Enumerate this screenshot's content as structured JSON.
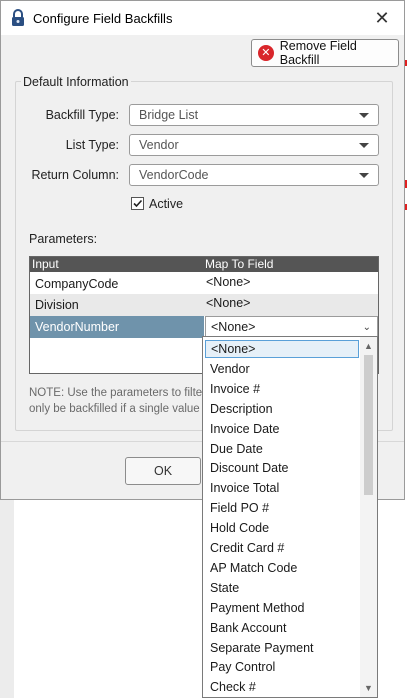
{
  "dialog": {
    "title": "Configure Field Backfills",
    "close_label": "✕",
    "remove_button_label": "Remove Field Backfill",
    "group_title": "Default Information",
    "fields": {
      "backfill_type_label": "Backfill Type:",
      "backfill_type_value": "Bridge List",
      "list_type_label": "List Type:",
      "list_type_value": "Vendor",
      "return_column_label": "Return Column:",
      "return_column_value": "VendorCode"
    },
    "active_label": "Active",
    "active_checked": true,
    "parameters_label": "Parameters:",
    "grid": {
      "columns": [
        "Input",
        "Map To Field"
      ],
      "rows": [
        {
          "input": "CompanyCode",
          "map": "<None>"
        },
        {
          "input": "Division",
          "map": "<None>"
        },
        {
          "input": "VendorNumber",
          "map": "<None>"
        }
      ]
    },
    "note": "NOTE: Use the parameters to filte\nonly be backfilled if a single value",
    "ok_label": "OK"
  },
  "dropdown": {
    "selected": "<None>",
    "options": [
      "<None>",
      "Vendor",
      "Invoice #",
      "Description",
      "Invoice Date",
      "Due Date",
      "Discount Date",
      "Invoice Total",
      "Field PO #",
      "Hold Code",
      "Credit Card #",
      "AP Match Code",
      "State",
      "Payment Method",
      "Bank Account",
      "Separate Payment",
      "Pay Control",
      "Check #"
    ]
  },
  "colors": {
    "accent_selected_row": "#6f93ab",
    "grid_header": "#555555",
    "remove_icon": "#d9262b"
  }
}
